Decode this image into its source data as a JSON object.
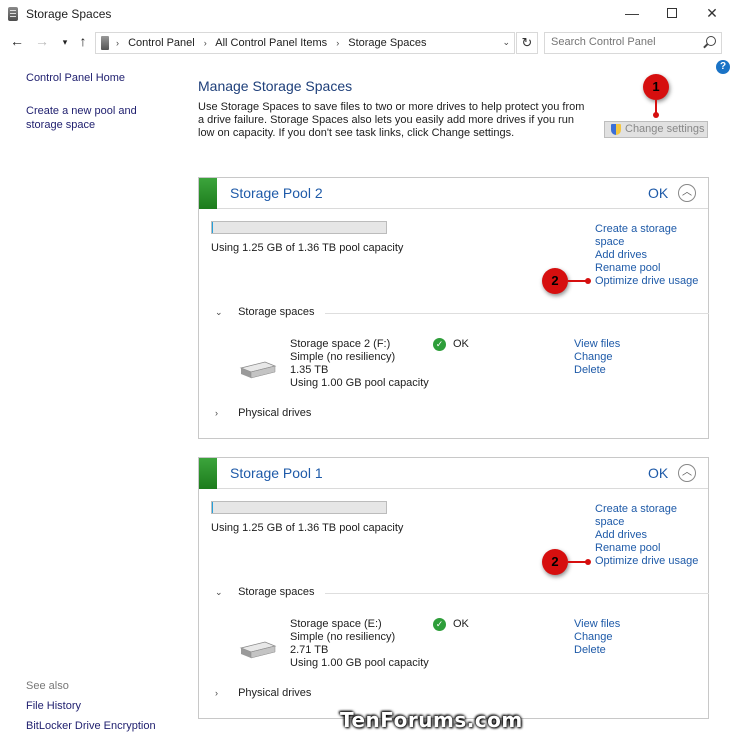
{
  "window": {
    "title": "Storage Spaces",
    "controls": {
      "minimize": "—",
      "close": "✕"
    }
  },
  "nav": {
    "back": "←",
    "forward": "→",
    "recent": "▾",
    "up": "↑",
    "breadcrumbs": [
      "Control Panel",
      "All Control Panel Items",
      "Storage Spaces"
    ],
    "breadcrumb_separator": "›",
    "address_dropdown": "⌄",
    "refresh": "↻",
    "search_placeholder": "Search Control Panel"
  },
  "help_label": "?",
  "sidebar": {
    "home": "Control Panel Home",
    "create_pool": "Create a new pool and storage space",
    "see_also": "See also",
    "file_history": "File History",
    "bitlocker": "BitLocker Drive Encryption"
  },
  "main": {
    "title": "Manage Storage Spaces",
    "description": "Use Storage Spaces to save files to two or more drives to help protect you from a drive failure. Storage Spaces also lets you easily add more drives if you run low on capacity. If you don't see task links, click Change settings.",
    "change_settings": "Change settings"
  },
  "markers": {
    "one": "1",
    "two": "2"
  },
  "pools": [
    {
      "name": "Storage Pool 2",
      "status": "OK",
      "collapse": "︿",
      "usage_fraction": 0.001,
      "usage_text": "Using 1.25 GB of 1.36 TB pool capacity",
      "links": [
        "Create a storage space",
        "Add drives",
        "Rename pool",
        "Optimize drive usage"
      ],
      "storage_spaces_label": "Storage spaces",
      "chev_open": "⌄",
      "chev_closed": "›",
      "space": {
        "name": "Storage space 2 (F:)",
        "type": "Simple (no resiliency)",
        "size": "1.35 TB",
        "usage": "Using 1.00 GB pool capacity",
        "status": "OK",
        "links": [
          "View files",
          "Change",
          "Delete"
        ]
      },
      "physical_drives_label": "Physical drives"
    },
    {
      "name": "Storage Pool 1",
      "status": "OK",
      "collapse": "︿",
      "usage_fraction": 0.001,
      "usage_text": "Using 1.25 GB of 1.36 TB pool capacity",
      "links": [
        "Create a storage space",
        "Add drives",
        "Rename pool",
        "Optimize drive usage"
      ],
      "storage_spaces_label": "Storage spaces",
      "chev_open": "⌄",
      "chev_closed": "›",
      "space": {
        "name": "Storage space (E:)",
        "type": "Simple (no resiliency)",
        "size": "2.71 TB",
        "usage": "Using 1.00 GB pool capacity",
        "status": "OK",
        "links": [
          "View files",
          "Change",
          "Delete"
        ]
      },
      "physical_drives_label": "Physical drives"
    }
  ],
  "ok_check": "✓",
  "watermark": "TenForums.com",
  "colors": {
    "accent_green": "#1d7c1d",
    "link_blue": "#1e5aa8",
    "marker_red": "#d60f0f",
    "ok_green": "#2e9e3a"
  }
}
